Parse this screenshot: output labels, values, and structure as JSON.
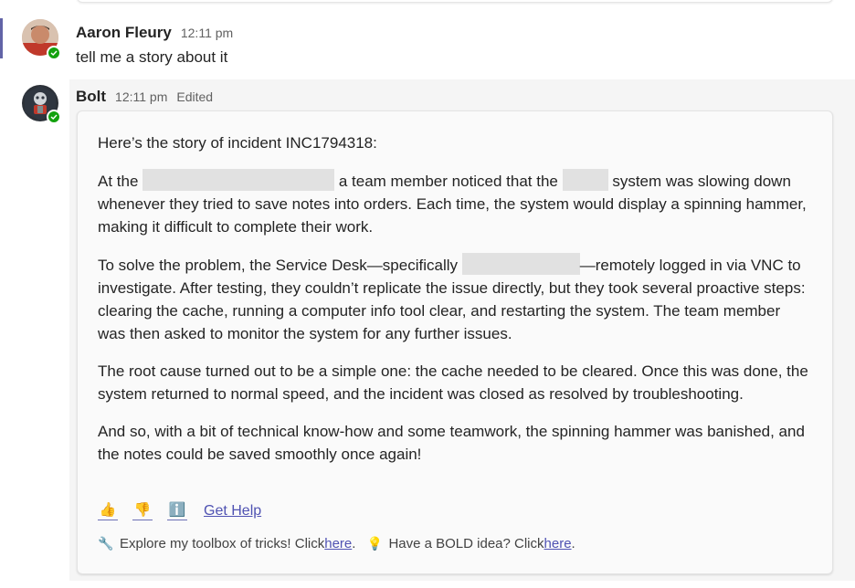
{
  "message1": {
    "author": "Aaron Fleury",
    "time": "12:11 pm",
    "text": "tell me a story about it"
  },
  "message2": {
    "author": "Bolt",
    "time": "12:11 pm",
    "edited": "Edited",
    "p1": "Here’s the story of incident INC1794318:",
    "p2_a": "At the ",
    "p2_b": " a team member noticed that the ",
    "p2_c": " system was slowing down whenever they tried to save notes into orders. Each time, the system would display a spinning hammer, making it difficult to complete their work.",
    "p3_a": "To solve the problem, the Service Desk—specifically ",
    "p3_b": "—remotely logged in via VNC to investigate. After testing, they couldn’t replicate the issue directly, but they took several proactive steps: clearing the cache, running a computer info tool clear, and restarting the system. The team member was then asked to monitor the system for any further issues.",
    "p4": "The root cause turned out to be a simple one: the cache needed to be cleared. Once this was done, the system returned to normal speed, and the incident was closed as resolved by troubleshooting.",
    "p5": "And so, with a bit of technical know-how and some teamwork, the spinning hammer was banished, and the notes could be saved smoothly once again!",
    "actions": {
      "thumbs_up_icon": "👍",
      "thumbs_down_icon": "👎",
      "info_icon": "ℹ️",
      "get_help": "Get Help"
    },
    "footer": {
      "toolbox_icon": "🔧",
      "toolbox_text": "Explore my toolbox of tricks! Click ",
      "toolbox_link": "here",
      "idea_icon": "💡",
      "idea_text": "Have a BOLD idea? Click ",
      "idea_link": "here",
      "period": "."
    }
  },
  "colors": {
    "accent": "#6264a7",
    "presence": "#13a10e",
    "link": "#4f52b2"
  }
}
